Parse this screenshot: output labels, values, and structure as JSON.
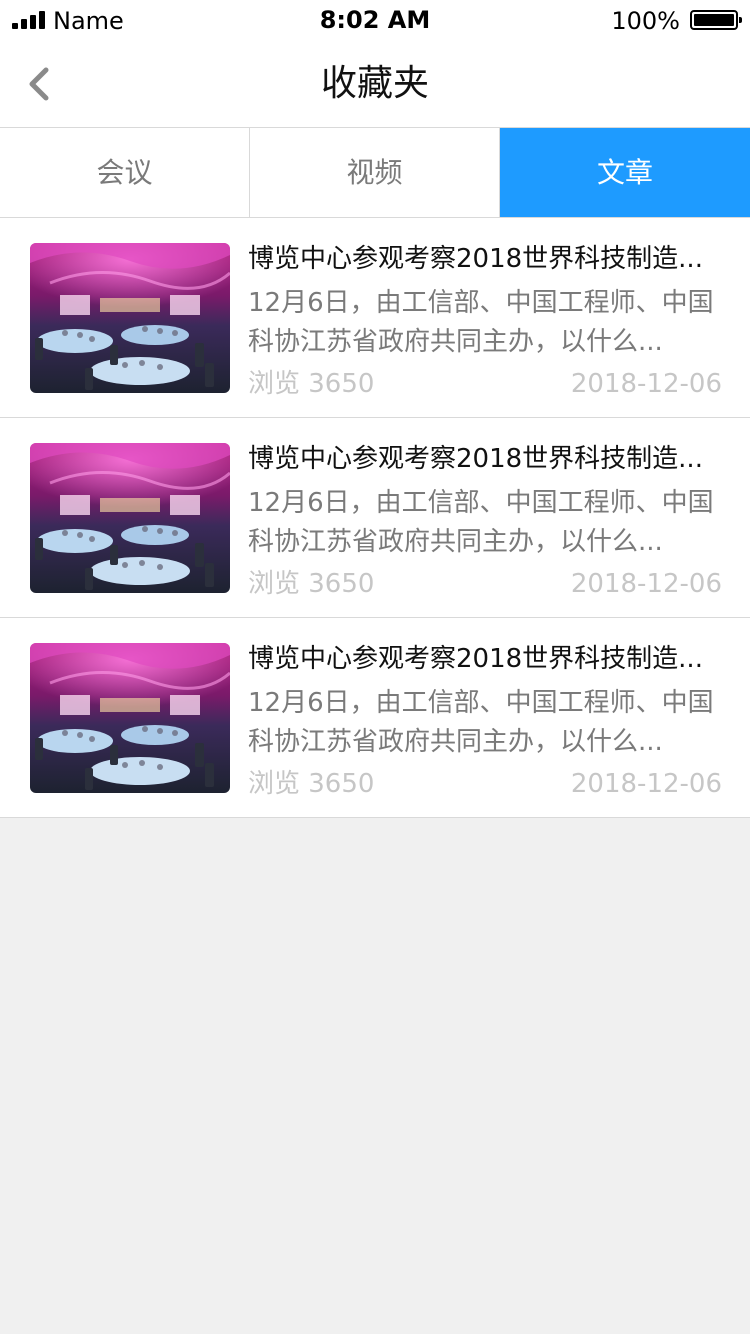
{
  "status_bar": {
    "carrier": "Name",
    "time": "8:02 AM",
    "battery": "100%"
  },
  "nav": {
    "title": "收藏夹",
    "back_icon": "chevron-left-icon"
  },
  "tabs": [
    {
      "label": "会议",
      "active": false
    },
    {
      "label": "视频",
      "active": false
    },
    {
      "label": "文章",
      "active": true
    }
  ],
  "colors": {
    "accent": "#1e9bff",
    "muted": "#7a7a7a",
    "faint": "#c6c6c6",
    "background": "#f0f0f0"
  },
  "articles": [
    {
      "title": "博览中心参观考察2018世界科技制造...",
      "summary": "12月6日，由工信部、中国工程师、中国科协江苏省政府共同主办，以什么...",
      "views": "浏览 3650",
      "date": "2018-12-06"
    },
    {
      "title": "博览中心参观考察2018世界科技制造...",
      "summary": "12月6日，由工信部、中国工程师、中国科协江苏省政府共同主办，以什么...",
      "views": "浏览 3650",
      "date": "2018-12-06"
    },
    {
      "title": "博览中心参观考察2018世界科技制造...",
      "summary": "12月6日，由工信部、中国工程师、中国科协江苏省政府共同主办，以什么...",
      "views": "浏览 3650",
      "date": "2018-12-06"
    }
  ]
}
